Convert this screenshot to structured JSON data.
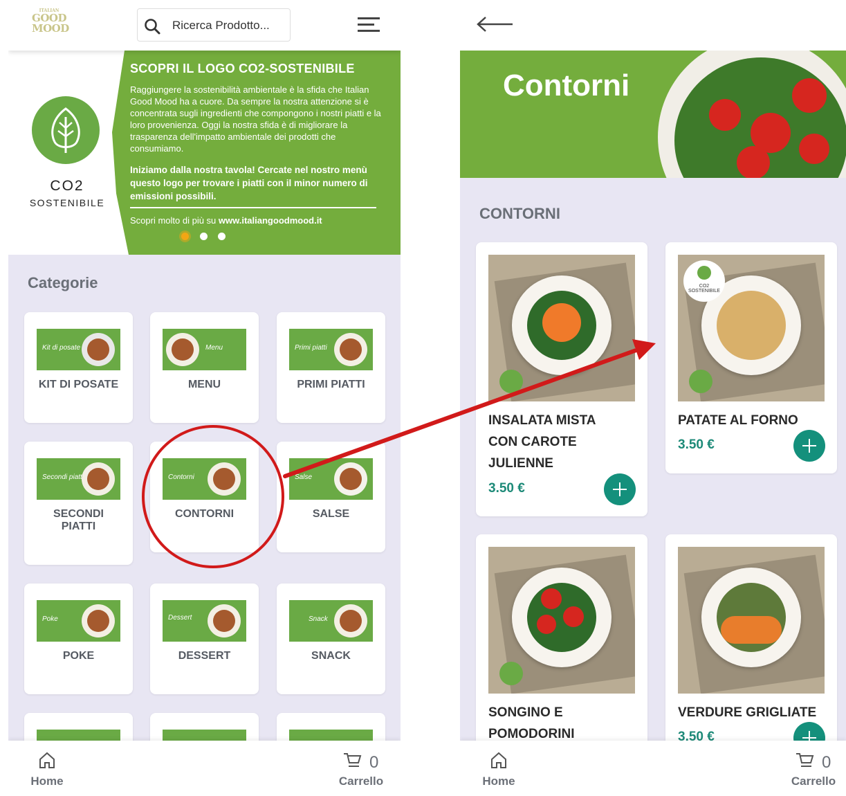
{
  "left_screen": {
    "logo": {
      "top": "ITALIAN",
      "line1": "GOOD",
      "line2": "MOOD"
    },
    "search": {
      "placeholder": "Ricerca Prodotto..."
    },
    "banner": {
      "co2_title": "CO2",
      "co2_subtitle": "SOSTENIBILE",
      "heading": "SCOPRI IL LOGO CO2-SOSTENIBILE",
      "paragraph1": "Raggiungere la sostenibilità ambientale è la sfida che Italian Good Mood ha a cuore. Da sempre la nostra attenzione si è concentrata sugli ingredienti che compongono i nostri piatti e la loro provenienza. Oggi la nostra sfida è di migliorare la trasparenza dell'impatto ambientale dei prodotti che consumiamo.",
      "paragraph2": "Iniziamo dalla nostra tavola! Cercate nel nostro menù questo logo per trovare i piatti con il minor numero di emissioni possibili.",
      "footer_prefix": "Scopri molto di più su",
      "footer_link": "www.italiangoodmood.it"
    },
    "section_title": "Categorie",
    "categories": [
      {
        "label": "KIT DI POSATE",
        "thumb_text": "Kit di posate"
      },
      {
        "label": "MENU",
        "thumb_text": "Menu"
      },
      {
        "label": "PRIMI PIATTI",
        "thumb_text": "Primi piatti"
      },
      {
        "label": "SECONDI PIATTI",
        "thumb_text": "Secondi piatti"
      },
      {
        "label": "CONTORNI",
        "thumb_text": "Contorni"
      },
      {
        "label": "SALSE",
        "thumb_text": "Salse"
      },
      {
        "label": "POKE",
        "thumb_text": "Poke"
      },
      {
        "label": "DESSERT",
        "thumb_text": "Dessert"
      },
      {
        "label": "SNACK",
        "thumb_text": "Snack"
      }
    ],
    "nav": {
      "home": "Home",
      "cart": "Carrello",
      "cart_count": "0"
    }
  },
  "right_screen": {
    "hero_title": "Contorni",
    "section_title": "CONTORNI",
    "products": [
      {
        "name": "INSALATA MISTA CON CAROTE JULIENNE",
        "price": "3.50 €",
        "badge": ""
      },
      {
        "name": "PATATE AL FORNO",
        "price": "3.50 €",
        "badge": "CO2 SOSTENIBILE"
      },
      {
        "name": "SONGINO E POMODORINI",
        "price": "",
        "badge": ""
      },
      {
        "name": "VERDURE GRIGLIATE",
        "price": "3.50 €",
        "badge": ""
      }
    ],
    "nav": {
      "home": "Home",
      "cart": "Carrello",
      "cart_count": "0"
    }
  },
  "colors": {
    "brand_green": "#74ad3d",
    "price_teal": "#1d8a78",
    "add_button": "#14907c",
    "annotation_red": "#d11a1a",
    "background": "#e8e6f3"
  },
  "icons": {
    "search": "search-icon",
    "menu": "hamburger-menu-icon",
    "back": "back-arrow-icon",
    "home": "home-icon",
    "cart": "cart-icon",
    "leaf": "leaf-icon",
    "add": "plus-icon"
  }
}
